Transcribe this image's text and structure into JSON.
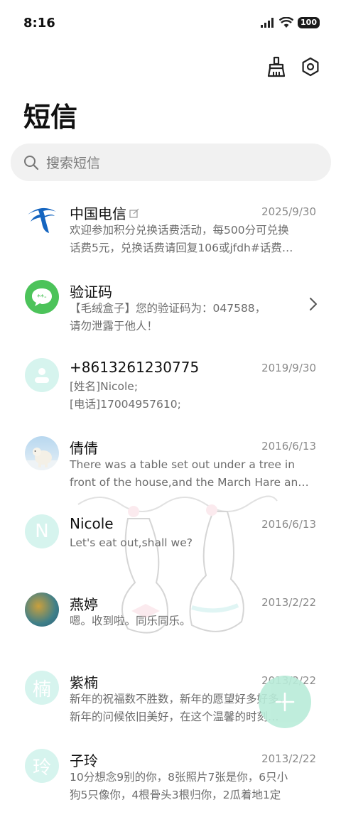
{
  "status": {
    "time": "8:16",
    "battery": "100"
  },
  "header": {
    "title": "短信"
  },
  "search": {
    "placeholder": "搜索短信"
  },
  "messages": [
    {
      "name": "中国电信",
      "date": "2025/9/30",
      "line1": "欢迎参加积分兑换话费活动，每500分可兑换",
      "line2": "话费5元，兑换话费请回复106或jfdh#话费…"
    },
    {
      "name": "验证码",
      "date": "",
      "line1": "【毛绒盒子】您的验证码为：047588，",
      "line2": "请勿泄露于他人！"
    },
    {
      "name": "+8613261230775",
      "date": "2019/9/30",
      "line1": "[姓名]Nicole;",
      "line2": "[电话]17004957610;"
    },
    {
      "name": "倩倩",
      "date": "2016/6/13",
      "line1": "There was a table set out under a tree in",
      "line2": "front of the house,and the March Hare an…"
    },
    {
      "name": "Nicole",
      "date": "2016/6/13",
      "avatar": "N",
      "line1": "Let's eat out,shall we?",
      "line2": ""
    },
    {
      "name": "燕婷",
      "date": "2013/2/22",
      "line1": "嗯。收到啦。同乐同乐。",
      "line2": ""
    },
    {
      "name": "紫楠",
      "date": "2013/2/22",
      "avatar": "楠",
      "line1": "新年的祝福数不胜数，新年的愿望好多好多，",
      "line2": "新年的问候依旧美好，在这个温馨的时刻…"
    },
    {
      "name": "子玲",
      "date": "2013/2/22",
      "avatar": "玲",
      "line1": "10分想念9别的你，8张照片7张是你，6只小",
      "line2": "狗5只像你，4根骨头3根归你，2瓜着地1定"
    }
  ],
  "colors": {
    "accent": "#b9ecd9",
    "avatar_bg": "#d6f4ee",
    "verify_green": "#4cc35a",
    "telecom_blue": "#1565c0"
  }
}
